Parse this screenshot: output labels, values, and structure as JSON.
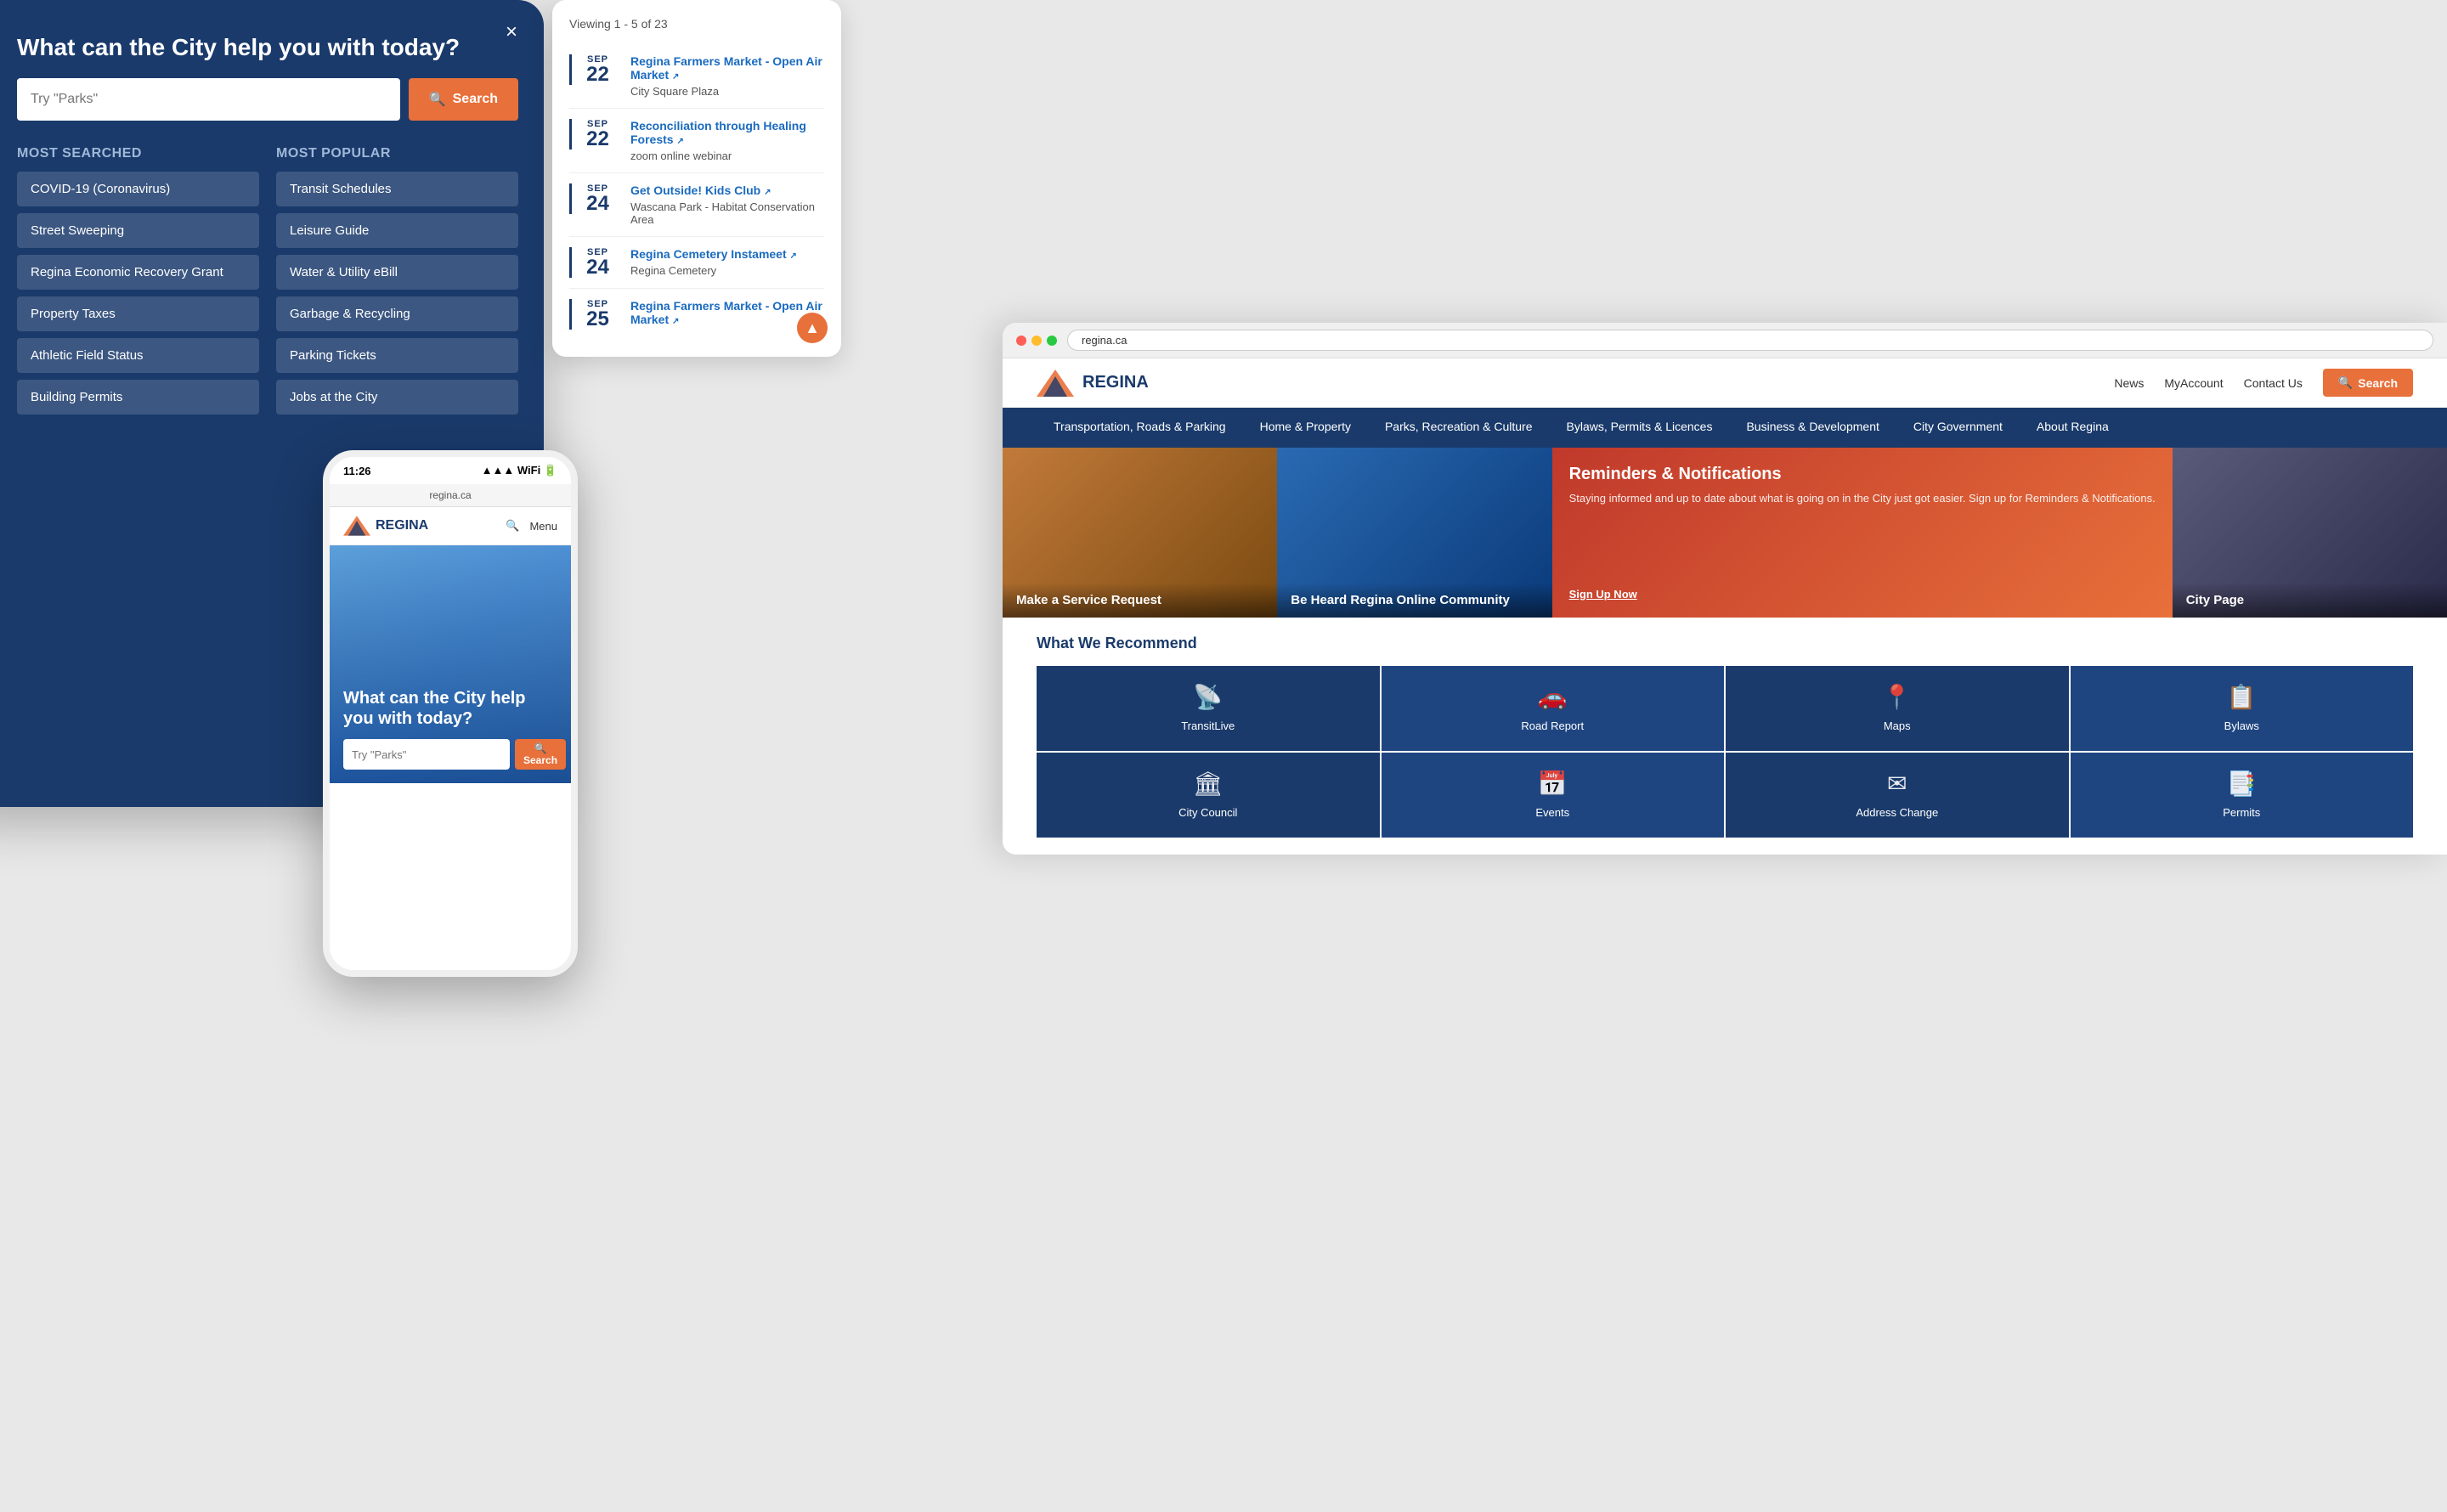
{
  "tablet": {
    "title": "What can the City help you with today?",
    "search_placeholder": "Try \"Parks\"",
    "search_button": "Search",
    "close": "×",
    "most_searched_title": "Most Searched",
    "most_popular_title": "Most Popular",
    "most_searched": [
      {
        "label": "COVID-19 (Coronavirus)"
      },
      {
        "label": "Street Sweeping"
      },
      {
        "label": "Regina Economic Recovery Grant"
      },
      {
        "label": "Property Taxes"
      },
      {
        "label": "Athletic Field Status"
      },
      {
        "label": "Building Permits"
      }
    ],
    "most_popular": [
      {
        "label": "Transit Schedules"
      },
      {
        "label": "Leisure Guide"
      },
      {
        "label": "Water & Utility eBill"
      },
      {
        "label": "Garbage & Recycling"
      },
      {
        "label": "Parking Tickets"
      },
      {
        "label": "Jobs at the City"
      }
    ]
  },
  "events": {
    "viewing_text": "Viewing 1 - 5 of 23",
    "items": [
      {
        "month": "SEP",
        "day": "22",
        "title": "Regina Farmers Market - Open Air Market",
        "location": "City Square Plaza"
      },
      {
        "month": "SEP",
        "day": "22",
        "title": "Reconciliation through Healing Forests",
        "location": "zoom online webinar"
      },
      {
        "month": "SEP",
        "day": "24",
        "title": "Get Outside! Kids Club",
        "location": "Wascana Park - Habitat Conservation Area"
      },
      {
        "month": "SEP",
        "day": "24",
        "title": "Regina Cemetery Instameet",
        "location": "Regina Cemetery"
      },
      {
        "month": "SEP",
        "day": "25",
        "title": "Regina Farmers Market - Open Air Market",
        "location": ""
      }
    ]
  },
  "phone": {
    "time": "11:26",
    "url": "regina.ca",
    "logo_text": "REGINA",
    "menu": "Menu",
    "hero_title": "What can the City help you with today?",
    "search_placeholder": "Try \"Parks\"",
    "search_button": "Search"
  },
  "desktop": {
    "url": "regina.ca",
    "header": {
      "logo_text": "REGINA",
      "links": [
        "News",
        "MyAccount",
        "Contact Us"
      ],
      "search_button": "Search"
    },
    "nav": {
      "items": [
        "Transportation, Roads & Parking",
        "Home & Property",
        "Parks, Recreation & Culture",
        "Bylaws, Permits & Licences",
        "Business & Development",
        "City Government",
        "About Regina"
      ]
    },
    "hero": {
      "slides": [
        {
          "label": "Make a Service Request",
          "color1": "#c27a3a",
          "color2": "#8a5520"
        },
        {
          "label": "Be Heard Regina Online Community",
          "color1": "#3a7ac2",
          "color2": "#1a4a8a"
        },
        {
          "label": "City Page",
          "color1": "#5a5a7a",
          "color2": "#3a3a5a"
        }
      ],
      "reminders": {
        "title": "Reminders & Notifications",
        "text": "Staying informed and up to date about what is going on in the City just got easier. Sign up for Reminders & Notifications.",
        "link": "Sign Up Now"
      }
    },
    "recommend": {
      "title": "What We Recommend",
      "items": [
        {
          "label": "TransitLive",
          "icon": "📡"
        },
        {
          "label": "Road Report",
          "icon": "🚗"
        },
        {
          "label": "Maps",
          "icon": "📍"
        },
        {
          "label": "Bylaws",
          "icon": "📋"
        },
        {
          "label": "City Council",
          "icon": "🏛"
        },
        {
          "label": "Events",
          "icon": "📅"
        },
        {
          "label": "Address Change",
          "icon": "✉"
        },
        {
          "label": "Permits",
          "icon": "📑"
        }
      ]
    }
  }
}
